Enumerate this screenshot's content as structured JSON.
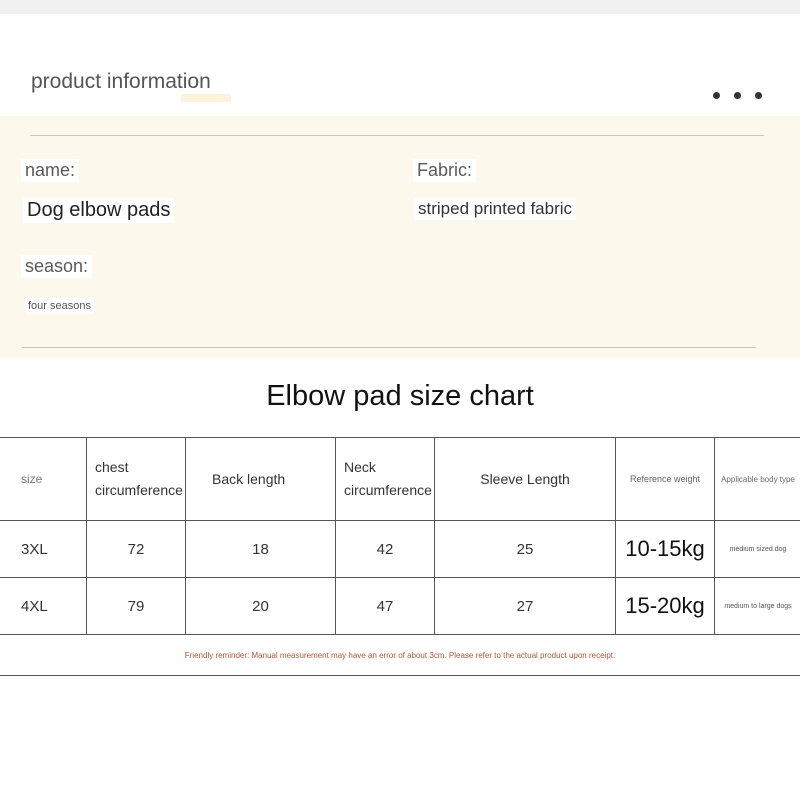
{
  "header": {
    "title": "product information"
  },
  "info": {
    "name_label": "name:",
    "name_value": "Dog elbow pads",
    "fabric_label": "Fabric:",
    "fabric_value": "striped printed fabric",
    "season_label": "season:",
    "season_value": "four seasons"
  },
  "chart": {
    "title": "Elbow pad size chart",
    "headers": [
      "size",
      "chest circumference",
      "Back length",
      "Neck circumference",
      "Sleeve Length",
      "Reference weight",
      "Applicable body type"
    ],
    "rows": [
      [
        "3XL",
        "72",
        "18",
        "42",
        "25",
        "10-15kg",
        "medium sized dog"
      ],
      [
        "4XL",
        "79",
        "20",
        "47",
        "27",
        "15-20kg",
        "medium to large dogs"
      ]
    ],
    "reminder": "Friendly reminder: Manual measurement may have an error of about 3cm. Please refer to the actual product upon receipt."
  }
}
